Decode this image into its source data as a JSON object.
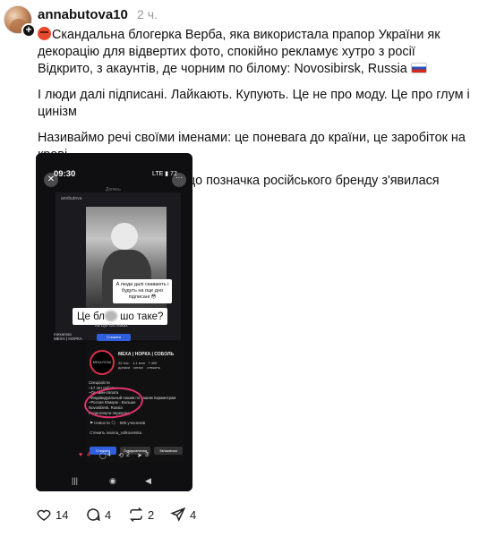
{
  "author": {
    "username": "annabutova10",
    "time": "2 ч."
  },
  "post": {
    "line1_text": "Скандальна блогерка Верба, яка використала прапор України як декорацію для відвертих фото, спокійно рекламує хутро з росії\nВідкрито, з акаунтів, де чорним по білому: Novosibirsk, Russia",
    "para2": "І люди далі підписані. Лайкають. Купують. Це не про моду. Це про глум і цинізм",
    "para3": "Називаймо речі своїми іменами: це поневага до країни, це заробіток на крові",
    "para4": "Сама блогерка каже, що позначка російського бренду з'явилася випадково"
  },
  "screenshot": {
    "time": "09:30",
    "network": "LTE ▮ 72",
    "header_label": "Допись",
    "inner_user": "annbutova",
    "bubble1": "А люди далі скавають і будуть на оце дно підписані 😳",
    "bubble2_a": "Це бл",
    "bubble2_b": "шо таке?",
    "caption": "на Цю Сістемах",
    "sub_name": "mexarosa\nМЕХА | НОРКА",
    "sub_btn": "Стежити",
    "logo_text": "MEXA ROSA",
    "profile_name": "МЕХА | НОРКА | СОБОЛЬ",
    "stats": "22 тис.   1,1 млн   7 400\nдописи   читачі    стежить",
    "bio": "Спеціалісти\n~17 лет работы\n~Онлайн-оплата\n~Индивидуальный пошив по вашим параметрам\n~Россия Юморю  - Больше\nNovosibirsk, Russia\nПереглянути переклад",
    "news": "⚑ Новости 🗨 · 585 учасників",
    "follow": "Стежить ivanna_volkovetska",
    "btn_follow": "Стежити",
    "btn_msg": "Повідомлення",
    "btn_contact": "Зв'язатися",
    "likes": "4",
    "comments": "4",
    "reposts": "2",
    "shares": "3"
  },
  "actions": {
    "likes": "14",
    "comments": "4",
    "reposts": "2",
    "shares": "4"
  },
  "colors": {
    "accent_red": "#e83a5a",
    "button_blue": "#2f5fdc",
    "phone_bg": "#0f0f12"
  }
}
